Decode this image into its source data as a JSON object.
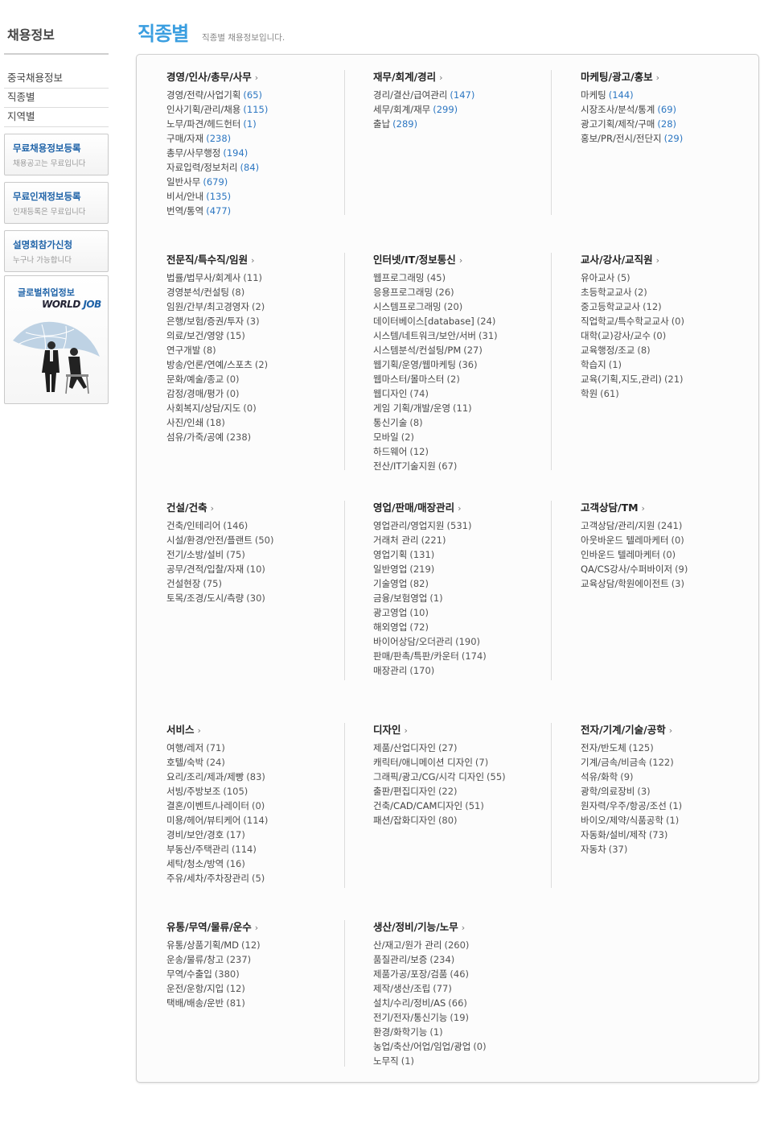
{
  "sidebar": {
    "title": "채용정보",
    "menu": [
      "중국채용정보",
      "직종별",
      "지역별"
    ],
    "promos": [
      {
        "title": "무료채용정보등록",
        "sub": "채용공고는 무료입니다"
      },
      {
        "title": "무료인재정보등록",
        "sub": "인재등록은 무료입니다"
      },
      {
        "title": "설명회참가신청",
        "sub": "누구나 가능합니다"
      }
    ],
    "world_job": {
      "label": "글로벌취업정보",
      "logo_a": "WORLD ",
      "logo_b": "JOB"
    }
  },
  "header": {
    "title": "직종별",
    "subtitle": "직종별 채용정보입니다."
  },
  "arrow": "›",
  "colors": {
    "title_blue": "#3a9ee0",
    "count_blue": "#2d77c2",
    "promo_blue": "#1f63a8"
  },
  "categories": [
    [
      {
        "title": "경영/인사/총무/사무",
        "blue": true,
        "items": [
          {
            "name": "경영/전략/사업기획",
            "count": "(65)"
          },
          {
            "name": "인사기획/관리/채용",
            "count": "(115)"
          },
          {
            "name": "노무/파견/헤드헌터",
            "count": "(1)"
          },
          {
            "name": "구매/자재",
            "count": "(238)"
          },
          {
            "name": "총무/사무행정",
            "count": "(194)"
          },
          {
            "name": "자료입력/정보처리",
            "count": "(84)"
          },
          {
            "name": "일반사무",
            "count": "(679)"
          },
          {
            "name": "비서/안내",
            "count": "(135)"
          },
          {
            "name": "번역/통역",
            "count": "(477)"
          }
        ]
      },
      {
        "title": "재무/회계/경리",
        "blue": true,
        "items": [
          {
            "name": "경리/결산/급여관리",
            "count": "(147)"
          },
          {
            "name": "세무/회계/재무",
            "count": "(299)"
          },
          {
            "name": "출납",
            "count": "(289)"
          }
        ]
      },
      {
        "title": "마케팅/광고/홍보",
        "blue": true,
        "items": [
          {
            "name": "마케팅",
            "count": "(144)"
          },
          {
            "name": "시장조사/분석/통계",
            "count": "(69)"
          },
          {
            "name": "광고기획/제작/구매",
            "count": "(28)"
          },
          {
            "name": "홍보/PR/전시/전단지",
            "count": "(29)"
          }
        ]
      }
    ],
    [
      {
        "title": "전문직/특수직/임원",
        "blue": false,
        "items": [
          {
            "name": "법률/법무사/회계사",
            "count": "(11)"
          },
          {
            "name": "경영분석/컨설팅",
            "count": "(8)"
          },
          {
            "name": "임원/간부/최고경영자",
            "count": "(2)"
          },
          {
            "name": "은행/보험/증권/투자",
            "count": "(3)"
          },
          {
            "name": "의료/보건/영양",
            "count": "(15)"
          },
          {
            "name": "연구개발",
            "count": "(8)"
          },
          {
            "name": "방송/언론/연예/스포츠",
            "count": "(2)"
          },
          {
            "name": "문화/예술/종교",
            "count": "(0)"
          },
          {
            "name": "감정/경매/평가",
            "count": "(0)"
          },
          {
            "name": "사회복지/상담/지도",
            "count": "(0)"
          },
          {
            "name": "사진/인쇄",
            "count": "(18)"
          },
          {
            "name": "섬유/가죽/공예",
            "count": "(238)"
          }
        ]
      },
      {
        "title": "인터넷/IT/정보통신",
        "blue": false,
        "items": [
          {
            "name": "웹프로그래밍",
            "count": "(45)"
          },
          {
            "name": "응용프로그래밍",
            "count": "(26)"
          },
          {
            "name": "시스템프로그래밍",
            "count": "(20)"
          },
          {
            "name": "데이터베이스[database]",
            "count": "(24)"
          },
          {
            "name": "시스템/네트워크/보안/서버",
            "count": "(31)"
          },
          {
            "name": "시스템분석/컨설팅/PM",
            "count": "(27)"
          },
          {
            "name": "웹기획/운영/웹마케팅",
            "count": "(36)"
          },
          {
            "name": "웹마스터/몰마스터",
            "count": "(2)"
          },
          {
            "name": "웹디자인",
            "count": "(74)"
          },
          {
            "name": "게임 기획/개발/운영",
            "count": "(11)"
          },
          {
            "name": "통신기술",
            "count": "(8)"
          },
          {
            "name": "모바일",
            "count": "(2)"
          },
          {
            "name": "하드웨어",
            "count": "(12)"
          },
          {
            "name": "전산/IT기술지원",
            "count": "(67)"
          }
        ]
      },
      {
        "title": "교사/강사/교직원",
        "blue": false,
        "items": [
          {
            "name": "유아교사",
            "count": "(5)"
          },
          {
            "name": "초등학교교사",
            "count": "(2)"
          },
          {
            "name": "중고등학교교사",
            "count": "(12)"
          },
          {
            "name": "직업학교/특수학교교사",
            "count": "(0)"
          },
          {
            "name": "대학(교)강사/교수",
            "count": "(0)"
          },
          {
            "name": "교육행정/조교",
            "count": "(8)"
          },
          {
            "name": "학습지",
            "count": "(1)"
          },
          {
            "name": "교육(기획,지도,관리)",
            "count": "(21)"
          },
          {
            "name": "학원",
            "count": "(61)"
          }
        ]
      }
    ],
    [
      {
        "title": "건설/건축",
        "blue": false,
        "items": [
          {
            "name": "건축/인테리어",
            "count": "(146)"
          },
          {
            "name": "시설/환경/안전/플랜트",
            "count": "(50)"
          },
          {
            "name": "전기/소방/설비",
            "count": "(75)"
          },
          {
            "name": "공무/견적/입찰/자재",
            "count": "(10)"
          },
          {
            "name": "건설현장",
            "count": "(75)"
          },
          {
            "name": "토목/조경/도시/측량",
            "count": "(30)"
          }
        ]
      },
      {
        "title": "영업/판매/매장관리",
        "blue": false,
        "items": [
          {
            "name": "영업관리/영업지원",
            "count": "(531)"
          },
          {
            "name": "거래처 관리",
            "count": "(221)"
          },
          {
            "name": "영업기획",
            "count": "(131)"
          },
          {
            "name": "일반영업",
            "count": "(219)"
          },
          {
            "name": "기술영업",
            "count": "(82)"
          },
          {
            "name": "금융/보험영업",
            "count": "(1)"
          },
          {
            "name": "광고영업",
            "count": "(10)"
          },
          {
            "name": "해외영업",
            "count": "(72)"
          },
          {
            "name": "바이어상담/오더관리",
            "count": "(190)"
          },
          {
            "name": "판매/판촉/특판/카운터",
            "count": "(174)"
          },
          {
            "name": "매장관리",
            "count": "(170)"
          }
        ]
      },
      {
        "title": "고객상담/TM",
        "blue": false,
        "items": [
          {
            "name": "고객상담/관리/지원",
            "count": "(241)"
          },
          {
            "name": "아웃바운드 텔레마케터",
            "count": "(0)"
          },
          {
            "name": "인바운드 텔레마케터",
            "count": "(0)"
          },
          {
            "name": "QA/CS강사/수퍼바이저",
            "count": "(9)"
          },
          {
            "name": "교육상담/학원에이전트",
            "count": "(3)"
          }
        ]
      }
    ],
    [
      {
        "title": "서비스",
        "blue": false,
        "items": [
          {
            "name": "여행/레저",
            "count": "(71)"
          },
          {
            "name": "호텔/숙박",
            "count": "(24)"
          },
          {
            "name": "요리/조리/제과/제빵",
            "count": "(83)"
          },
          {
            "name": "서빙/주방보조",
            "count": "(105)"
          },
          {
            "name": "결혼/이벤트/나레이터",
            "count": "(0)"
          },
          {
            "name": "미용/헤어/뷰티케어",
            "count": "(114)"
          },
          {
            "name": "경비/보안/경호",
            "count": "(17)"
          },
          {
            "name": "부동산/주택관리",
            "count": "(114)"
          },
          {
            "name": "세탁/청소/방역",
            "count": "(16)"
          },
          {
            "name": "주유/세차/주차장관리",
            "count": "(5)"
          }
        ]
      },
      {
        "title": "디자인",
        "blue": false,
        "items": [
          {
            "name": "제품/산업디자인",
            "count": "(27)"
          },
          {
            "name": "캐릭터/애니메이션 디자인",
            "count": "(7)"
          },
          {
            "name": "그래픽/광고/CG/시각 디자인",
            "count": "(55)"
          },
          {
            "name": "출판/편집디자인",
            "count": "(22)"
          },
          {
            "name": "건축/CAD/CAM디자인",
            "count": "(51)"
          },
          {
            "name": "패션/잡화디자인",
            "count": "(80)"
          }
        ]
      },
      {
        "title": "전자/기계/기술/공학",
        "blue": false,
        "items": [
          {
            "name": "전자/반도체",
            "count": "(125)"
          },
          {
            "name": "기계/금속/비금속",
            "count": "(122)"
          },
          {
            "name": "석유/화학",
            "count": "(9)"
          },
          {
            "name": "광학/의료장비",
            "count": "(3)"
          },
          {
            "name": "원자력/우주/항공/조선",
            "count": "(1)"
          },
          {
            "name": "바이오/제약/식품공학",
            "count": "(1)"
          },
          {
            "name": "자동화/설비/제작",
            "count": "(73)"
          },
          {
            "name": "자동차",
            "count": "(37)"
          }
        ]
      }
    ],
    [
      {
        "title": "유통/무역/물류/운수",
        "blue": false,
        "items": [
          {
            "name": "유통/상품기획/MD",
            "count": "(12)"
          },
          {
            "name": "운송/물류/창고",
            "count": "(237)"
          },
          {
            "name": "무역/수출입",
            "count": "(380)"
          },
          {
            "name": "운전/운항/지입",
            "count": "(12)"
          },
          {
            "name": "택배/배송/운반",
            "count": "(81)"
          }
        ]
      },
      {
        "title": "생산/정비/기능/노무",
        "blue": false,
        "items": [
          {
            "name": "산/재고/원가 관리",
            "count": "(260)"
          },
          {
            "name": "품질관리/보증",
            "count": "(234)"
          },
          {
            "name": "제품가공/포장/검품",
            "count": "(46)"
          },
          {
            "name": "제작/생산/조립",
            "count": "(77)"
          },
          {
            "name": "설치/수리/정비/AS",
            "count": "(66)"
          },
          {
            "name": "전기/전자/통신기능",
            "count": "(19)"
          },
          {
            "name": "환경/화학기능",
            "count": "(1)"
          },
          {
            "name": "농업/축산/어업/임업/광업",
            "count": "(0)"
          },
          {
            "name": "노무직",
            "count": "(1)"
          }
        ]
      }
    ]
  ]
}
